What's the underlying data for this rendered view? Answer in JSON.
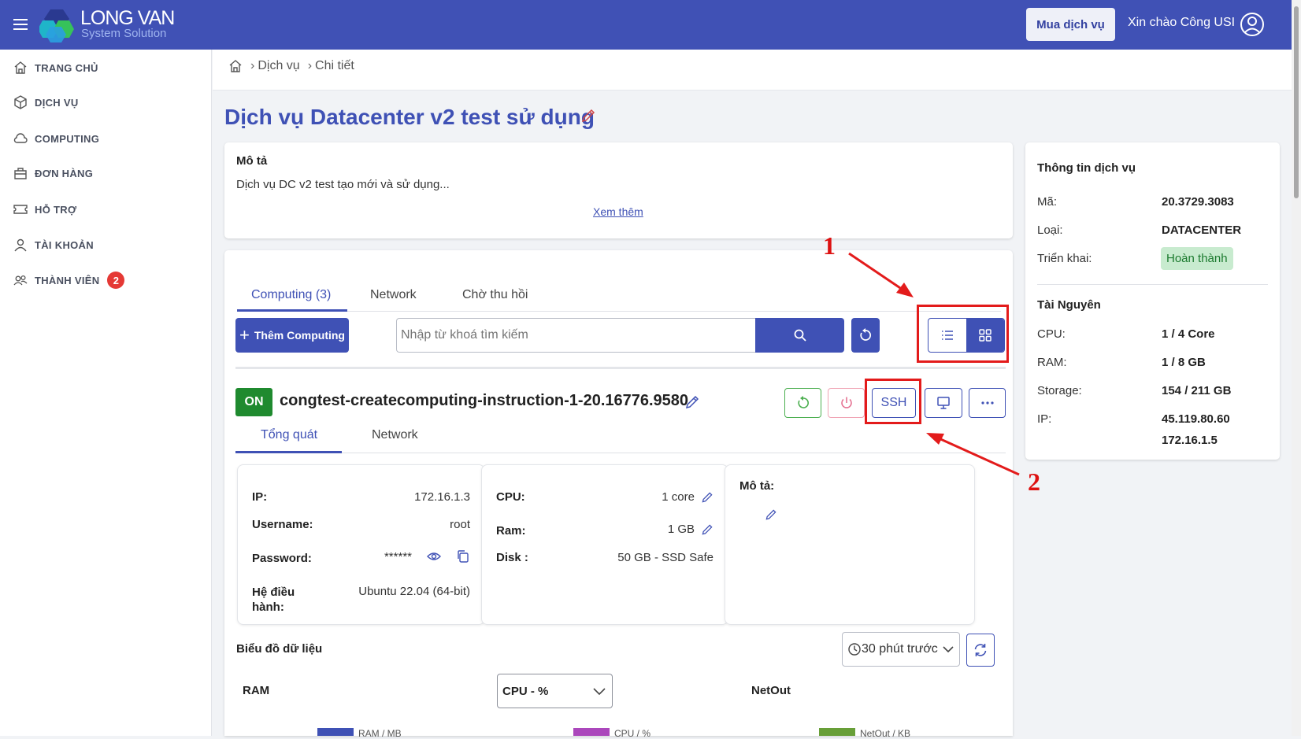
{
  "header": {
    "logo_title": "LONG VAN",
    "logo_subtitle": "System Solution",
    "buy_button": "Mua dịch vụ",
    "greeting": "Xin chào Công USI"
  },
  "sidebar": {
    "items": [
      {
        "label": "TRANG CHỦ",
        "icon": "home-icon"
      },
      {
        "label": "DỊCH VỤ",
        "icon": "box-icon"
      },
      {
        "label": "COMPUTING",
        "icon": "cloud-icon"
      },
      {
        "label": "ĐƠN HÀNG",
        "icon": "bag-icon"
      },
      {
        "label": "HỖ TRỢ",
        "icon": "ticket-icon"
      },
      {
        "label": "TÀI KHOẢN",
        "icon": "user-icon"
      },
      {
        "label": "THÀNH VIÊN",
        "icon": "users-icon",
        "badge": "2"
      }
    ]
  },
  "breadcrumb": [
    "Dịch vụ",
    "Chi tiết"
  ],
  "page_title": "Dịch vụ Datacenter v2 test sử dụng",
  "description": {
    "heading": "Mô tả",
    "text": "Dịch vụ DC v2 test tạo mới và sử dụng...",
    "more_link": "Xem thêm"
  },
  "tabs": [
    "Computing (3)",
    "Network",
    "Chờ thu hồi"
  ],
  "toolbar": {
    "add_label": "Thêm Computing",
    "search_placeholder": "Nhập từ khoá tìm kiếm"
  },
  "instance": {
    "status": "ON",
    "name": "congtest-createcomputing-instruction-1-20.16776.9580",
    "ssh_label": "SSH",
    "subtabs": [
      "Tổng quát",
      "Network"
    ],
    "general": {
      "ip_label": "IP:",
      "ip": "172.16.1.3",
      "username_label": "Username:",
      "username": "root",
      "password_label": "Password:",
      "password": "******",
      "os_label": "Hệ điều hành:",
      "os": "Ubuntu 22.04 (64-bit)"
    },
    "resources": {
      "cpu_label": "CPU:",
      "cpu": "1 core",
      "ram_label": "Ram:",
      "ram": "1 GB",
      "disk_label": "Disk :",
      "disk": "50 GB - SSD Safe"
    },
    "note_label": "Mô tả:"
  },
  "charts": {
    "title": "Biểu đồ dữ liệu",
    "time_range": "30 phút trước",
    "ram_label": "RAM",
    "cpu_select": "CPU - %",
    "netout_label": "NetOut",
    "legend": [
      {
        "label": "RAM / MB",
        "color": "#3f51b5"
      },
      {
        "label": "CPU / %",
        "color": "#ab47bc"
      },
      {
        "label": "NetOut / KB",
        "color": "#689f38"
      }
    ]
  },
  "service_info": {
    "heading": "Thông tin dịch vụ",
    "code_label": "Mã:",
    "code": "20.3729.3083",
    "type_label": "Loại:",
    "type": "DATACENTER",
    "deploy_label": "Triển khai:",
    "deploy_status": "Hoàn thành",
    "resources_heading": "Tài Nguyên",
    "cpu_label": "CPU:",
    "cpu": "1 / 4 Core",
    "ram_label": "RAM:",
    "ram": "1 / 8 GB",
    "storage_label": "Storage:",
    "storage": "154 / 211 GB",
    "ip_label": "IP:",
    "ip1": "45.119.80.60",
    "ip2": "172.16.1.5"
  },
  "annotations": [
    "1",
    "2"
  ],
  "colors": {
    "primary": "#3f51b5",
    "header": "#4051b5",
    "on_status": "#1f8a2f",
    "annotation": "#e31b1b"
  }
}
